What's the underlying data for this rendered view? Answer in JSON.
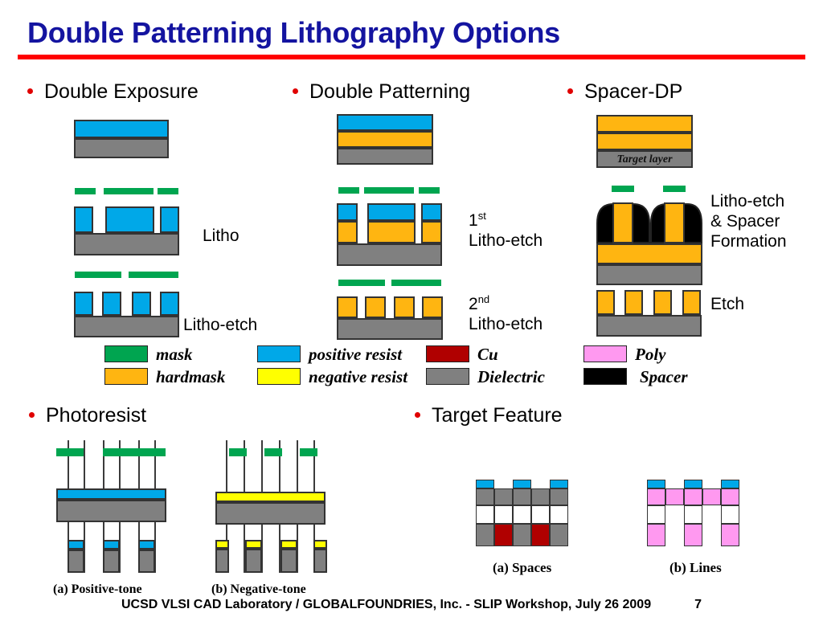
{
  "slide": {
    "title": "Double Patterning Lithography Options",
    "title_color": "#1414a0",
    "rule_color": "#ff0000"
  },
  "columns": [
    {
      "heading": "Double Exposure"
    },
    {
      "heading": "Double Patterning"
    },
    {
      "heading": "Spacer-DP"
    }
  ],
  "step_labels": {
    "de_litho": "Litho",
    "de_litho_etch": "Litho-etch",
    "dp_first_a": "1",
    "dp_first_sup": "st",
    "dp_first_b": "Litho-etch",
    "dp_second_a": "2",
    "dp_second_sup": "nd",
    "dp_second_b": "Litho-etch",
    "sp_line1": "Litho-etch",
    "sp_line2": "& Spacer",
    "sp_line3": "Formation",
    "sp_etch": "Etch"
  },
  "target_layer_label": "Target layer",
  "legend": {
    "items": [
      {
        "label": "mask",
        "color": "#00a550",
        "col": 0,
        "row": 0
      },
      {
        "label": "hardmask",
        "color": "#ffb511",
        "col": 0,
        "row": 1
      },
      {
        "label": "positive resist",
        "color": "#00a8e8",
        "col": 1,
        "row": 0
      },
      {
        "label": "negative resist",
        "color": "#ffff00",
        "col": 1,
        "row": 1
      },
      {
        "label": "Cu",
        "color": "#b00000",
        "col": 2,
        "row": 0
      },
      {
        "label": "Dielectric",
        "color": "#808080",
        "col": 2,
        "row": 1
      },
      {
        "label": "Poly",
        "color": "#ff99f0",
        "col": 3,
        "row": 0
      },
      {
        "label": "Spacer",
        "color": "#000000",
        "col": 3,
        "row": 1
      }
    ]
  },
  "bottom": {
    "photoresist_heading": "Photoresist",
    "target_heading": "Target Feature",
    "caption_positive": "(a) Positive-tone",
    "caption_negative": "(b) Negative-tone",
    "caption_spaces": "(a) Spaces",
    "caption_lines": "(b) Lines"
  },
  "footer": {
    "text": "UCSD VLSI CAD Laboratory  /   GLOBALFOUNDRIES, Inc.   - SLIP Workshop, July 26 2009",
    "page": "7"
  },
  "palette": {
    "mask_green": "#00a550",
    "positive_blue": "#00a8e8",
    "negative_yellow": "#ffff00",
    "hardmask_orange": "#ffb511",
    "dielectric_gray": "#808080",
    "cu_red": "#b00000",
    "poly_pink": "#ff99f0",
    "spacer_black": "#000000",
    "outline": "#333333"
  }
}
